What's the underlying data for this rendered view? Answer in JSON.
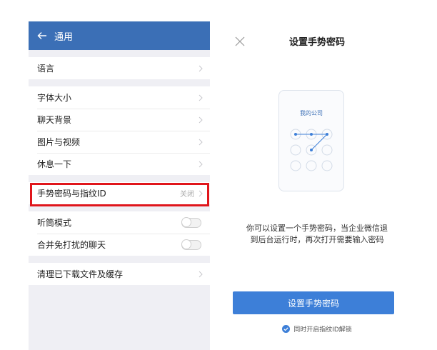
{
  "left": {
    "header": {
      "title": "通用"
    },
    "rows": {
      "language": "语言",
      "font_size": "字体大小",
      "chat_background": "聊天背景",
      "photos_videos": "图片与视频",
      "take_break": "休息一下",
      "gesture_password": {
        "label": "手势密码与指纹ID",
        "value": "关闭"
      },
      "earpiece_mode": "听筒模式",
      "merge_muted_chats": "合并免打扰的聊天",
      "clear_downloads": "清理已下载文件及缓存"
    }
  },
  "right": {
    "title": "设置手势密码",
    "preview_company": "我的公司",
    "description_line1": "你可以设置一个手势密码，当企业微信退",
    "description_line2": "到后台运行时，再次打开需要输入密码",
    "set_button": "设置手势密码",
    "touch_id_option": "同时开启指纹ID解锁"
  },
  "colors": {
    "header_bg": "#3b6fb6",
    "highlight": "#e0151b",
    "button_bg": "#3d7fd8"
  },
  "icons": [
    "back-arrow-icon",
    "chevron-right-icon",
    "close-icon",
    "check-circle-icon"
  ]
}
